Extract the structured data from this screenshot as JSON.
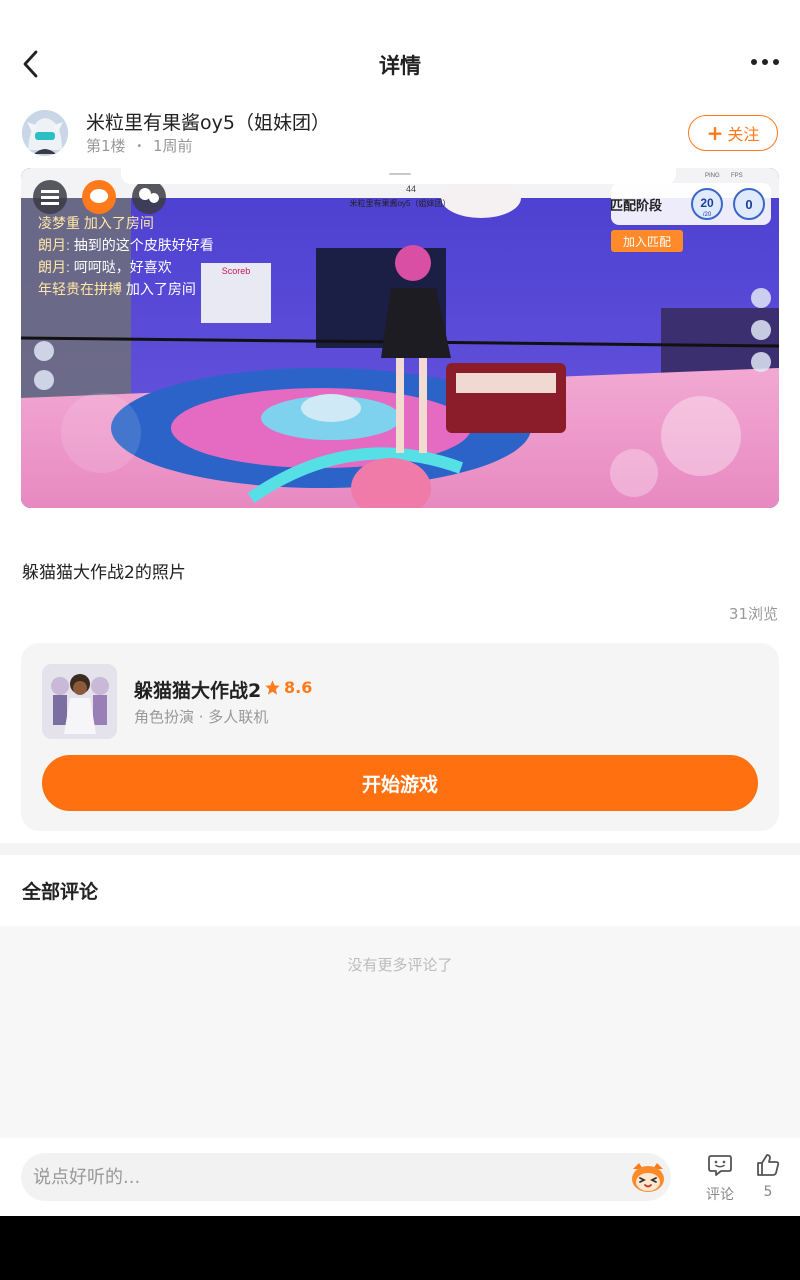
{
  "header": {
    "title": "详情",
    "back_icon": "chevron-left-icon",
    "more_icon": "more-dots-icon"
  },
  "post": {
    "author_name": "米粒里有果酱oy5（姐妹团）",
    "floor": "第1楼",
    "separator": "•",
    "time": "1周前",
    "follow_label": "关注",
    "caption": "躲猫猫大作战2的照片",
    "views": "31浏览"
  },
  "screenshot": {
    "chat_lines": [
      {
        "name": "朗月:",
        "text": " 抽到的这个皮肤好好看"
      },
      {
        "name": "朗月:",
        "text": " 呵呵哒，好喜欢"
      },
      {
        "name": "年轻贵在拼搏",
        "text": " 加入了房间"
      }
    ],
    "top_line": "凌梦重 加入了房间",
    "player_tag": "米粒里有果酱oy5（姐妹团）",
    "coin_count": "44",
    "phase_label": "匹配阶段",
    "join_match": "加入匹配",
    "count_a": "20",
    "count_a_sub": "/20",
    "count_b": "0",
    "score_sign": "Scoreb",
    "ping": "PING",
    "fps": "FPS"
  },
  "game_card": {
    "name": "躲猫猫大作战2",
    "rating": "8.6",
    "tags": "角色扮演 · 多人联机",
    "start_label": "开始游戏"
  },
  "comments": {
    "title": "全部评论",
    "empty_text": "没有更多评论了"
  },
  "bottom_bar": {
    "input_placeholder": "说点好听的...",
    "comment_label": "评论",
    "like_count": "5"
  },
  "colors": {
    "accent": "#ff7010",
    "follow": "#ff7a1a"
  }
}
